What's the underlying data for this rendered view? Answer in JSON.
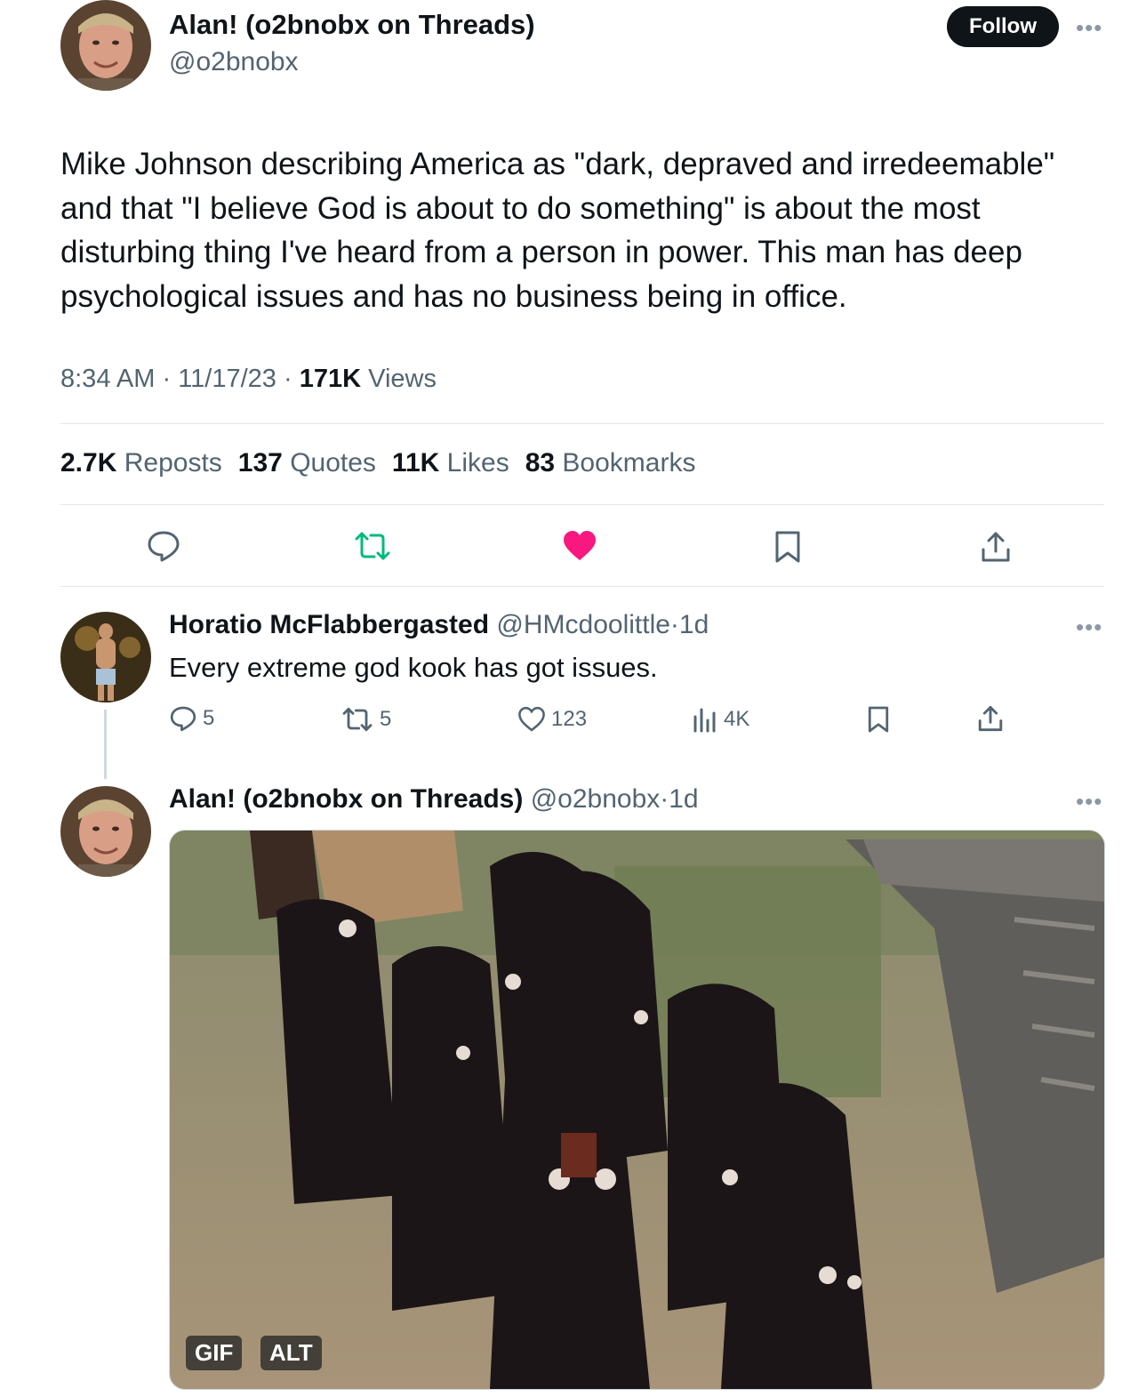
{
  "main_tweet": {
    "author_name": "Alan! (o2bnobx on Threads)",
    "handle": "@o2bnobx",
    "follow_label": "Follow",
    "text": "Mike Johnson describing America as \"dark, depraved and irredeemable\" and that \"I believe God is about to do something\" is about the most disturbing thing I've heard from a person in power.  This man has deep psychological issues and has no business being in office.",
    "time": "8:34 AM",
    "date": "11/17/23",
    "views_count": "171K",
    "views_label": "Views",
    "stats": [
      {
        "count": "2.7K",
        "label": "Reposts"
      },
      {
        "count": "137",
        "label": "Quotes"
      },
      {
        "count": "11K",
        "label": "Likes"
      },
      {
        "count": "83",
        "label": "Bookmarks"
      }
    ]
  },
  "reply": {
    "author_name": "Horatio McFlabbergasted",
    "handle": "@HMcdoolittle",
    "age": "1d",
    "text": "Every extreme god kook has got issues.",
    "replies": "5",
    "reposts": "5",
    "likes": "123",
    "views": "4K"
  },
  "thread_tweet": {
    "author_name": "Alan! (o2bnobx on Threads)",
    "handle": "@o2bnobx",
    "age": "1d",
    "gif_badge": "GIF",
    "alt_badge": "ALT"
  },
  "separator": "·",
  "colors": {
    "text": "#0f1419",
    "secondary": "#536471",
    "repost_green": "#00ba7c",
    "like_pink": "#f91880",
    "divider": "#e1e6ea"
  }
}
